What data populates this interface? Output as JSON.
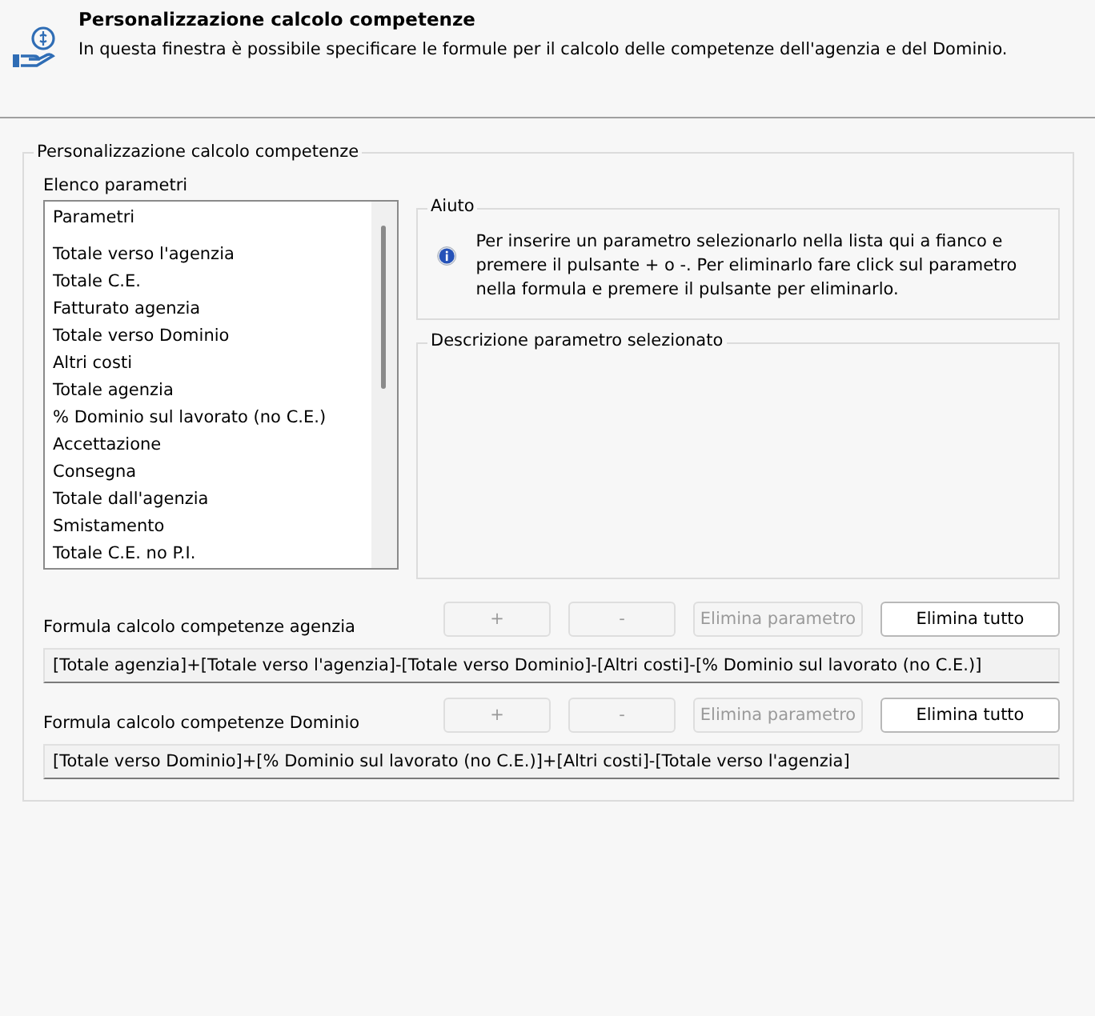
{
  "header": {
    "title": "Personalizzazione calcolo competenze",
    "description": "In questa finestra è possibile specificare le formule per il calcolo delle competenze dell'agenzia e del Dominio."
  },
  "group": {
    "title": "Personalizzazione calcolo competenze",
    "parameter_list": {
      "label": "Elenco parametri",
      "column_header": "Parametri",
      "items": [
        {
          "label": "Totale verso l'agenzia",
          "selected": false
        },
        {
          "label": "Totale C.E.",
          "selected": false
        },
        {
          "label": "Fatturato agenzia",
          "selected": false
        },
        {
          "label": "Totale verso Dominio",
          "selected": false
        },
        {
          "label": "Altri costi",
          "selected": false
        },
        {
          "label": "Totale agenzia",
          "selected": false
        },
        {
          "label": "% Dominio sul lavorato (no C.E.)",
          "selected": false
        },
        {
          "label": "Accettazione",
          "selected": false
        },
        {
          "label": "Consegna",
          "selected": false
        },
        {
          "label": "Totale dall'agenzia",
          "selected": false
        },
        {
          "label": "Smistamento",
          "selected": false
        },
        {
          "label": "Totale C.E. no P.I.",
          "selected": false
        }
      ]
    },
    "help": {
      "title": "Aiuto",
      "text": "Per inserire un parametro selezionarlo nella lista qui a fianco e premere il pulsante + o -. Per eliminarlo fare click sul parametro nella formula e premere il pulsante per eliminarlo."
    },
    "description": {
      "title": "Descrizione parametro selezionato"
    },
    "formulas": [
      {
        "label": "Formula calcolo competenze agenzia",
        "value": "[Totale agenzia]+[Totale verso l'agenzia]-[Totale verso Dominio]-[Altri costi]-[% Dominio sul lavorato (no C.E.)]",
        "buttons": [
          {
            "label": "+",
            "disabled": true
          },
          {
            "label": "-",
            "disabled": true
          },
          {
            "label": "Elimina parametro",
            "disabled": true
          },
          {
            "label": "Elimina tutto",
            "disabled": false
          }
        ]
      },
      {
        "label": "Formula calcolo competenze Dominio",
        "value": "[Totale verso Dominio]+[% Dominio sul lavorato (no C.E.)]+[Altri costi]-[Totale verso l'agenzia]",
        "buttons": [
          {
            "label": "+",
            "disabled": true
          },
          {
            "label": "-",
            "disabled": true
          },
          {
            "label": "Elimina parametro",
            "disabled": true
          },
          {
            "label": "Elimina tutto",
            "disabled": false
          }
        ]
      }
    ]
  }
}
